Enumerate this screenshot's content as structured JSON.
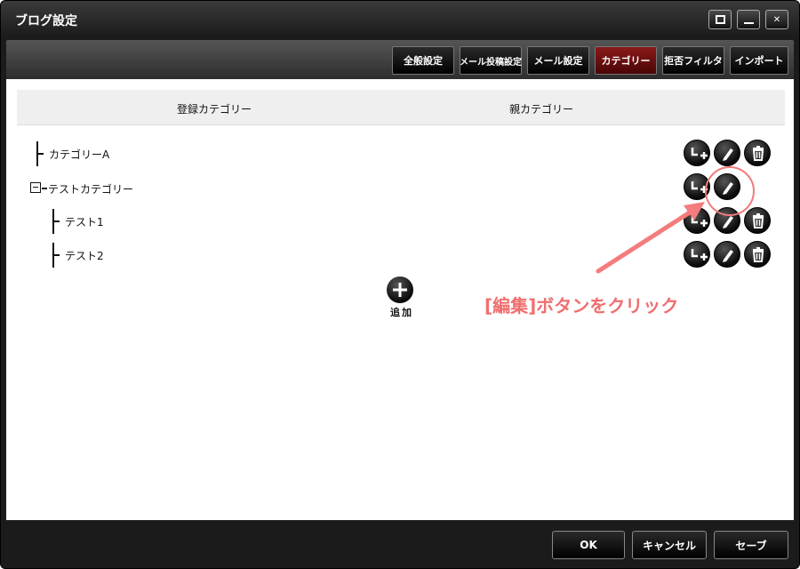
{
  "window": {
    "title": "ブログ設定"
  },
  "tabs": [
    {
      "label": "全般設定"
    },
    {
      "label": "メール投稿設定"
    },
    {
      "label": "メール設定"
    },
    {
      "label": "カテゴリー",
      "active": true
    },
    {
      "label": "拒否フィルタ"
    },
    {
      "label": "インポート"
    }
  ],
  "table": {
    "col_registered": "登録カテゴリー",
    "col_parent": "親カテゴリー"
  },
  "categories": [
    {
      "name": "カテゴリーA",
      "level": 0
    },
    {
      "name": "テストカテゴリー",
      "level": 0,
      "collapsible": true
    },
    {
      "name": "テスト1",
      "level": 1
    },
    {
      "name": "テスト2",
      "level": 1
    }
  ],
  "row_actions": [
    "move-icon",
    "edit-icon",
    "delete-icon"
  ],
  "add": {
    "label": "追加"
  },
  "annotation": {
    "text": "[編集]ボタンをクリック",
    "color": "#f06f6f"
  },
  "footer": {
    "ok": "OK",
    "cancel": "キャンセル",
    "save": "セーブ"
  },
  "colors": {
    "active_tab": "#7a1212",
    "chrome": "#1b1b1b"
  }
}
